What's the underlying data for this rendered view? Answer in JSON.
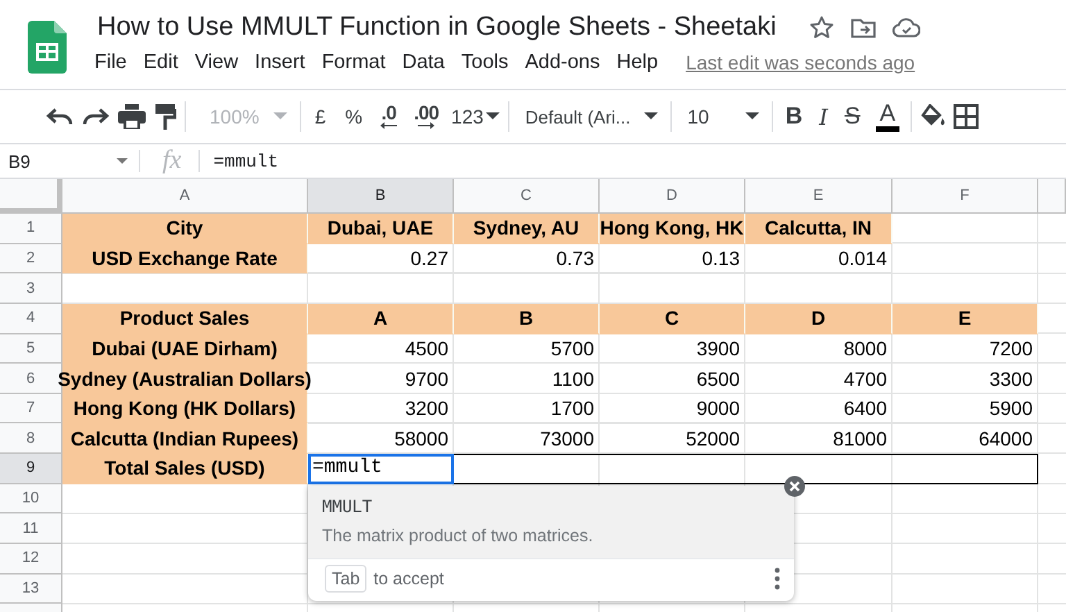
{
  "document": {
    "title": "How to Use MMULT Function in Google Sheets - Sheetaki",
    "last_edit": "Last edit was seconds ago"
  },
  "menu": [
    "File",
    "Edit",
    "View",
    "Insert",
    "Format",
    "Data",
    "Tools",
    "Add-ons",
    "Help"
  ],
  "toolbar": {
    "zoom": {
      "label": "100%",
      "disabled": true
    },
    "currency": "£",
    "percent": "%",
    "decrease_decimals": ".0",
    "increase_decimals": ".00",
    "number_format": "123",
    "font": "Default (Ari...",
    "font_size": "10",
    "bold": "B",
    "italic": "I",
    "strikethrough": "S",
    "text_color": "A"
  },
  "formula_bar": {
    "cell_reference": "B9",
    "fx": "fx",
    "formula": "=mmult"
  },
  "columns": [
    {
      "label": "A",
      "selected": false
    },
    {
      "label": "B",
      "selected": true
    },
    {
      "label": "C",
      "selected": false
    },
    {
      "label": "D",
      "selected": false
    },
    {
      "label": "E",
      "selected": false
    },
    {
      "label": "F",
      "selected": false
    }
  ],
  "rows": [
    {
      "number": "1",
      "selected": false,
      "cells": [
        {
          "kind": "header",
          "text": "City"
        },
        {
          "kind": "header",
          "text": "Dubai, UAE"
        },
        {
          "kind": "header",
          "text": "Sydney, AU"
        },
        {
          "kind": "header",
          "text": "Hong Kong, HK"
        },
        {
          "kind": "header",
          "text": "Calcutta, IN"
        },
        {
          "kind": "empty"
        }
      ]
    },
    {
      "number": "2",
      "selected": false,
      "cells": [
        {
          "kind": "header",
          "text": "USD Exchange Rate"
        },
        {
          "kind": "number",
          "text": "0.27"
        },
        {
          "kind": "number",
          "text": "0.73"
        },
        {
          "kind": "number",
          "text": "0.13"
        },
        {
          "kind": "number",
          "text": "0.014"
        },
        {
          "kind": "empty"
        }
      ]
    },
    {
      "number": "3",
      "selected": false,
      "cells": [
        {
          "kind": "empty"
        },
        {
          "kind": "empty"
        },
        {
          "kind": "empty"
        },
        {
          "kind": "empty"
        },
        {
          "kind": "empty"
        },
        {
          "kind": "empty"
        }
      ]
    },
    {
      "number": "4",
      "selected": false,
      "cells": [
        {
          "kind": "header",
          "text": "Product Sales"
        },
        {
          "kind": "header",
          "text": "A"
        },
        {
          "kind": "header",
          "text": "B"
        },
        {
          "kind": "header",
          "text": "C"
        },
        {
          "kind": "header",
          "text": "D"
        },
        {
          "kind": "header",
          "text": "E"
        }
      ]
    },
    {
      "number": "5",
      "selected": false,
      "cells": [
        {
          "kind": "header",
          "text": "Dubai (UAE Dirham)"
        },
        {
          "kind": "number",
          "text": "4500"
        },
        {
          "kind": "number",
          "text": "5700"
        },
        {
          "kind": "number",
          "text": "3900"
        },
        {
          "kind": "number",
          "text": "8000"
        },
        {
          "kind": "number",
          "text": "7200"
        }
      ]
    },
    {
      "number": "6",
      "selected": false,
      "cells": [
        {
          "kind": "header",
          "text": "Sydney (Australian Dollars)"
        },
        {
          "kind": "number",
          "text": "9700"
        },
        {
          "kind": "number",
          "text": "1100"
        },
        {
          "kind": "number",
          "text": "6500"
        },
        {
          "kind": "number",
          "text": "4700"
        },
        {
          "kind": "number",
          "text": "3300"
        }
      ]
    },
    {
      "number": "7",
      "selected": false,
      "cells": [
        {
          "kind": "header",
          "text": "Hong Kong (HK Dollars)"
        },
        {
          "kind": "number",
          "text": "3200"
        },
        {
          "kind": "number",
          "text": "1700"
        },
        {
          "kind": "number",
          "text": "9000"
        },
        {
          "kind": "number",
          "text": "6400"
        },
        {
          "kind": "number",
          "text": "5900"
        }
      ]
    },
    {
      "number": "8",
      "selected": false,
      "cells": [
        {
          "kind": "header",
          "text": "Calcutta (Indian Rupees)"
        },
        {
          "kind": "number",
          "text": "58000"
        },
        {
          "kind": "number",
          "text": "73000"
        },
        {
          "kind": "number",
          "text": "52000"
        },
        {
          "kind": "number",
          "text": "81000"
        },
        {
          "kind": "number",
          "text": "64000"
        }
      ]
    },
    {
      "number": "9",
      "selected": true,
      "cells": [
        {
          "kind": "header",
          "text": "Total Sales (USD)"
        },
        {
          "kind": "editing",
          "text": "=mmult"
        },
        {
          "kind": "range"
        },
        {
          "kind": "range"
        },
        {
          "kind": "range"
        },
        {
          "kind": "range"
        }
      ]
    },
    {
      "number": "10",
      "selected": false,
      "cells": []
    },
    {
      "number": "11",
      "selected": false,
      "cells": []
    },
    {
      "number": "12",
      "selected": false,
      "cells": []
    },
    {
      "number": "13",
      "selected": false,
      "cells": []
    }
  ],
  "suggestion": {
    "function": "MMULT",
    "description": "The matrix product of two matrices.",
    "key": "Tab",
    "hint": "to accept"
  }
}
